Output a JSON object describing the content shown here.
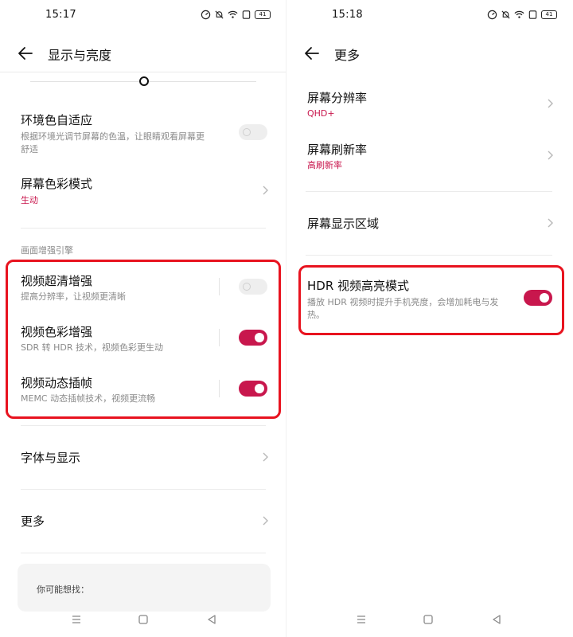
{
  "left": {
    "status_time": "15:17",
    "battery": "41",
    "title": "显示与亮度",
    "rows": {
      "ambient": {
        "title": "环境色自适应",
        "sub1": "根据环境光调节屏幕的色温，让眼睛观看屏幕更",
        "sub2": "舒适"
      },
      "color_mode": {
        "title": "屏幕色彩模式",
        "value": "生动"
      },
      "section_label": "画面增强引擎",
      "video_sr": {
        "title": "视频超清增强",
        "sub": "提高分辨率，让视频更清晰"
      },
      "video_color": {
        "title": "视频色彩增强",
        "sub": "SDR 转 HDR 技术，视频色彩更生动"
      },
      "video_interp": {
        "title": "视频动态插帧",
        "sub": "MEMC 动态插帧技术，视频更流畅"
      },
      "font_display": {
        "title": "字体与显示"
      },
      "more": {
        "title": "更多"
      }
    },
    "card_text": "你可能想找："
  },
  "right": {
    "status_time": "15:18",
    "battery": "41",
    "title": "更多",
    "rows": {
      "resolution": {
        "title": "屏幕分辨率",
        "value": "QHD+"
      },
      "refresh": {
        "title": "屏幕刷新率",
        "value": "高刷新率"
      },
      "display_area": {
        "title": "屏幕显示区域"
      },
      "hdr": {
        "title": "HDR 视频高亮模式",
        "sub1": "播放 HDR 视频时提升手机亮度，会增加耗电与发",
        "sub2": "热。"
      }
    }
  },
  "toggles": {
    "ambient": false,
    "video_sr": false,
    "video_color": true,
    "video_interp": true,
    "hdr": true
  },
  "colors": {
    "accent": "#c8174d",
    "highlight": "#e8131f"
  }
}
